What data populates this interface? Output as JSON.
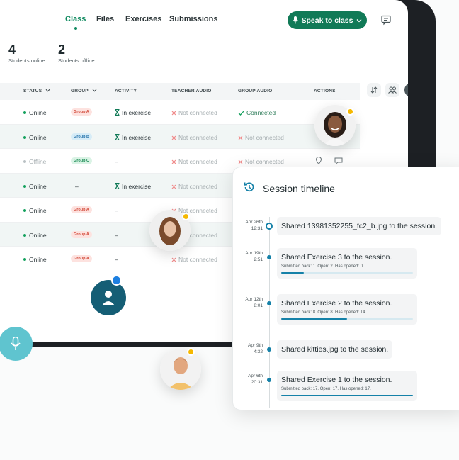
{
  "nav": {
    "tabs": [
      {
        "label": "Class",
        "active": true
      },
      {
        "label": "Files",
        "active": false
      },
      {
        "label": "Exercises",
        "active": false
      },
      {
        "label": "Submissions",
        "active": false
      }
    ],
    "speak_button": "Speak to class"
  },
  "stats": {
    "online": {
      "count": "4",
      "label": "Students online"
    },
    "offline": {
      "count": "2",
      "label": "Students offline"
    }
  },
  "table": {
    "headers": {
      "status": "STATUS",
      "group": "GROUP",
      "activity": "ACTIVITY",
      "teacher_audio": "TEACHER AUDIO",
      "group_audio": "GROUP AUDIO",
      "actions": "ACTIONS"
    },
    "rows": [
      {
        "status": "Online",
        "group": "Group A",
        "activity": "In exercise",
        "teacher_audio": "Not connected",
        "group_audio": "Connected"
      },
      {
        "status": "Online",
        "group": "Group B",
        "activity": "In exercise",
        "teacher_audio": "Not connected",
        "group_audio": "Not connected"
      },
      {
        "status": "Offline",
        "group": "Group C",
        "activity": "–",
        "teacher_audio": "Not connected",
        "group_audio": "Not connected"
      },
      {
        "status": "Online",
        "group": "–",
        "activity": "In exercise",
        "teacher_audio": "Not connected",
        "group_audio": ""
      },
      {
        "status": "Online",
        "group": "Group A",
        "activity": "–",
        "teacher_audio": "Not connected",
        "group_audio": ""
      },
      {
        "status": "Online",
        "group": "Group A",
        "activity": "–",
        "teacher_audio": "Not connected",
        "group_audio": ""
      },
      {
        "status": "Online",
        "group": "Group A",
        "activity": "–",
        "teacher_audio": "Not connected",
        "group_audio": ""
      }
    ]
  },
  "colors": {
    "accent_green": "#117a57",
    "online": "#12a05c",
    "offline": "#b9c1c4",
    "error_x": "#f08a8a",
    "timeline_blue": "#1581a8",
    "presence_yellow": "#f5b800",
    "presence_blue": "#1d7fe0"
  },
  "timeline": {
    "title": "Session timeline",
    "items": [
      {
        "date": "Apr 26th",
        "time": "12:31",
        "text": "Shared 13981352255_fc2_b.jpg to the session.",
        "sub": "",
        "progress": null
      },
      {
        "date": "Apr 19th",
        "time": "2:51",
        "text": "Shared Exercise 3 to the session.",
        "sub": "Submitted back: 1. Open: 2. Has opened: 0.",
        "progress": 0.17
      },
      {
        "date": "Apr 12th",
        "time": "8:01",
        "text": "Shared Exercise 2 to the session.",
        "sub": "Submitted back: 8. Open: 8. Has opened: 14.",
        "progress": 0.5
      },
      {
        "date": "Apr 9th",
        "time": "4:32",
        "text": "Shared kitties.jpg to the session.",
        "sub": "",
        "progress": null
      },
      {
        "date": "Apr 6th",
        "time": "20:31",
        "text": "Shared Exercise 1 to the session.",
        "sub": "Submitted back: 17. Open: 17. Has opened: 17.",
        "progress": 1.0
      }
    ]
  },
  "icons": [
    "mic-icon",
    "chevron-down-icon",
    "chat-icon",
    "user-settings-icon",
    "sort-icon",
    "users-icon",
    "layout-icon",
    "history-icon",
    "hourglass-icon",
    "check-icon",
    "x-icon",
    "location-icon",
    "comment-icon",
    "person-icon"
  ]
}
